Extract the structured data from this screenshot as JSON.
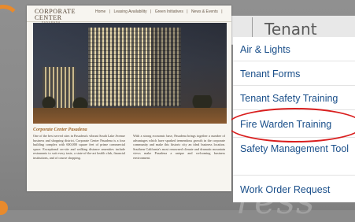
{
  "background": {
    "script_text": "ress",
    "accent_color": "#e88a2c"
  },
  "website": {
    "logo_line1": "CORPORATE",
    "logo_line2": "CENTER",
    "logo_city": "PASADENA",
    "nav": [
      "Home",
      "|",
      "Leasing Availability",
      "|",
      "Green Initiatives",
      "|",
      "News & Events",
      "|"
    ],
    "caption_title": "Corporate Center Pasadena",
    "paragraph_left": "One of the best served sites in Pasadena's vibrant South Lake Avenue business and shopping district, Corporate Center Pasadena is a four building complex with 600,000 square feet of prime commercial space. Exceptional on-site and walking distance amenities include restaurants to suit every taste, a state-of-the-art health club, financial institutions, and of course shopping.",
    "paragraph_right": "With a strong economic base, Pasadena brings together a number of advantages which have sparked tremendous growth in the corporate community and make this historic city an ideal business location. Southern California's most renowned climate and dramatic mountain views make Pasadena a unique and welcoming business environment."
  },
  "tenant_portal": {
    "cut_letter": "n",
    "title": "Tenant Portal",
    "menu": [
      {
        "label": "Air & Lights"
      },
      {
        "label": "Tenant Forms"
      },
      {
        "label": "Tenant Safety Training"
      },
      {
        "label": "Fire Warden Training"
      },
      {
        "label": "Safety Management Tool"
      },
      {
        "label": "Work Order Request"
      }
    ],
    "highlight_color": "#d91e1e",
    "link_color": "#1a4f8a"
  }
}
